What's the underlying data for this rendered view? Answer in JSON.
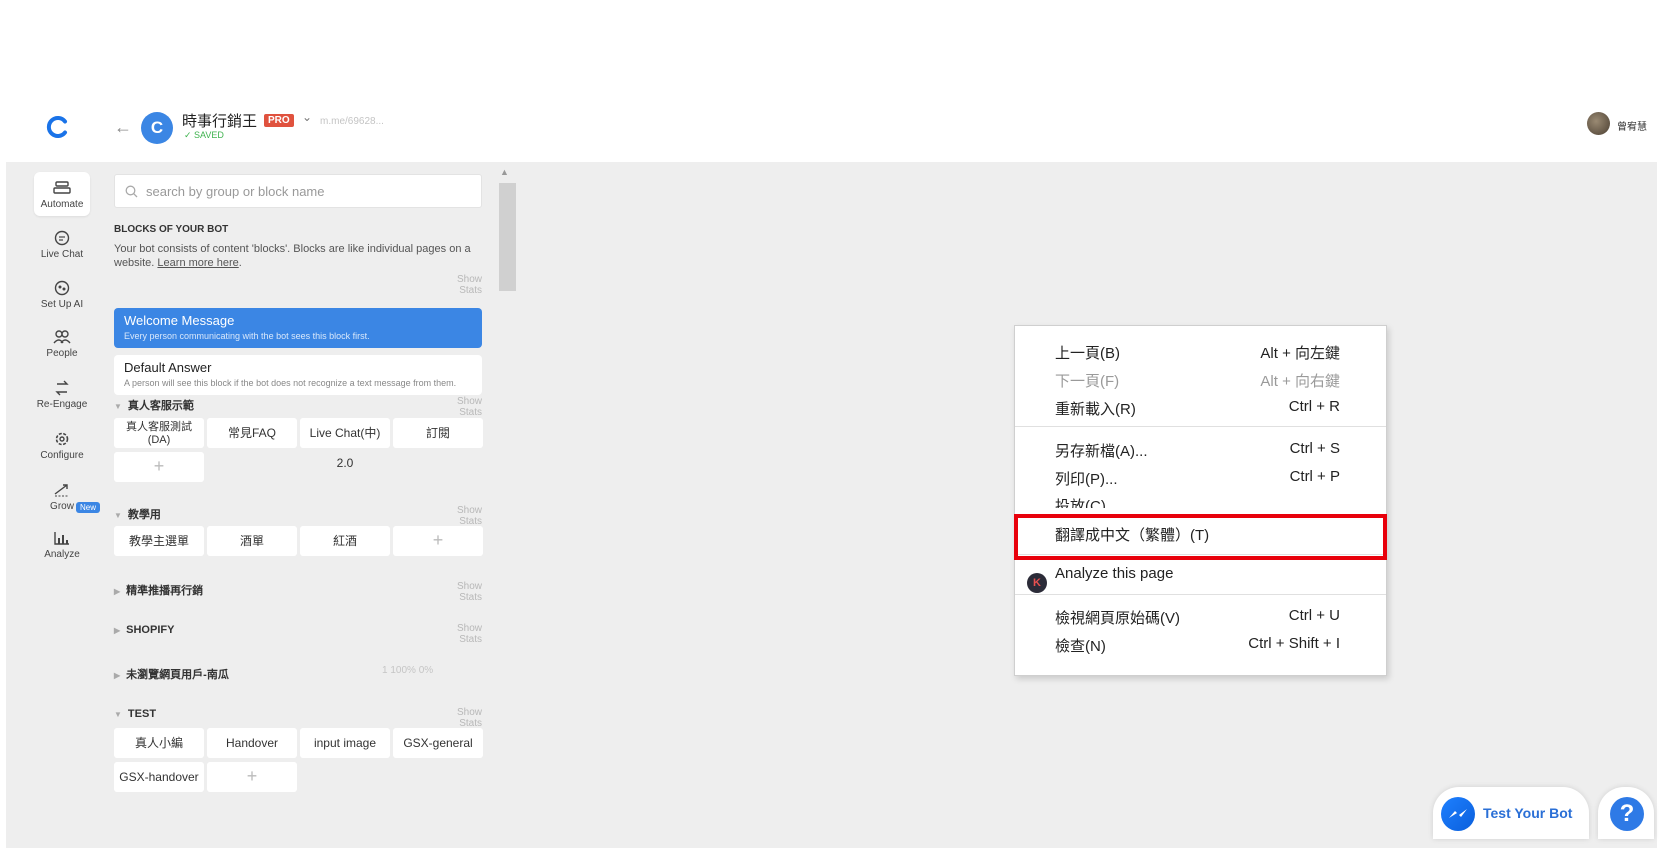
{
  "header": {
    "bot_initial": "C",
    "bot_name": "時事行銷王",
    "plan_badge": "PRO",
    "bot_url": "m.me/69628...",
    "saved_label": "SAVED",
    "user_name": "曾宥慧"
  },
  "nav": {
    "items": [
      {
        "label": "Automate",
        "icon": "automate-icon"
      },
      {
        "label": "Live Chat",
        "icon": "live-chat-icon"
      },
      {
        "label": "Set Up AI",
        "icon": "ai-icon"
      },
      {
        "label": "People",
        "icon": "people-icon"
      },
      {
        "label": "Re-Engage",
        "icon": "re-engage-icon"
      },
      {
        "label": "Configure",
        "icon": "gear-icon"
      },
      {
        "label": "Grow",
        "icon": "grow-icon"
      },
      {
        "label": "Analyze",
        "icon": "analyze-icon"
      }
    ],
    "new_badge": "New"
  },
  "panel": {
    "search_placeholder": "search by group or block name",
    "section_title": "BLOCKS OF YOUR BOT",
    "description": "Your bot consists of content 'blocks'. Blocks are like individual pages on a website.",
    "learn_more": "Learn more here",
    "show_stats": "Show Stats",
    "welcome": {
      "title": "Welcome Message",
      "subtitle": "Every person communicating with the bot sees this block first."
    },
    "default_answer": {
      "title": "Default Answer",
      "subtitle": "A person will see this block if the bot does not recognize a text message from them."
    },
    "groups": [
      {
        "title": "真人客服示範",
        "chips": [
          "真人客服測試\n(DA)",
          "常見FAQ",
          "Live Chat(中) 2.0",
          "訂閱"
        ]
      },
      {
        "title": "教學用",
        "chips": [
          "教學主選單",
          "酒單",
          "紅酒"
        ]
      },
      {
        "title": "精準推播再行銷",
        "chips": []
      },
      {
        "title": "SHOPIFY",
        "chips": []
      },
      {
        "title": "未瀏覽網頁用戶-南瓜",
        "chips": [],
        "stats": "1   100%   0%"
      },
      {
        "title": "TEST",
        "chips": [
          "真人小編",
          "Handover",
          "input image",
          "GSX-general",
          "GSX-handover"
        ]
      }
    ],
    "add_symbol": "+"
  },
  "context_menu": {
    "items": [
      {
        "label": "上一頁(B)",
        "shortcut": "Alt + 向左鍵",
        "disabled": false
      },
      {
        "label": "下一頁(F)",
        "shortcut": "Alt + 向右鍵",
        "disabled": true
      },
      {
        "label": "重新載入(R)",
        "shortcut": "Ctrl + R",
        "disabled": false
      },
      {
        "label": "另存新檔(A)...",
        "shortcut": "Ctrl + S",
        "disabled": false
      },
      {
        "label": "列印(P)...",
        "shortcut": "Ctrl + P",
        "disabled": false
      },
      {
        "label": "投放(C)...",
        "shortcut": "",
        "disabled": false
      },
      {
        "label": "翻譯成中文（繁體）(T)",
        "shortcut": "",
        "disabled": false
      },
      {
        "label": "Analyze this page",
        "shortcut": "",
        "disabled": false
      },
      {
        "label": "檢視網頁原始碼(V)",
        "shortcut": "Ctrl + U",
        "disabled": false
      },
      {
        "label": "檢查(N)",
        "shortcut": "Ctrl + Shift + I",
        "disabled": false
      }
    ],
    "highlight_color": "#e8000b"
  },
  "bottom": {
    "test_bot_label": "Test Your Bot",
    "help_label": "?"
  },
  "colors": {
    "accent": "#3b86e4",
    "pro_badge": "#e0523e",
    "saved": "#3fb34f"
  }
}
